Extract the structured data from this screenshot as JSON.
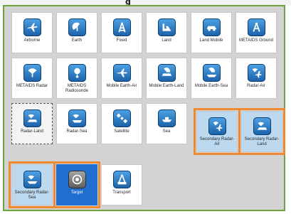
{
  "title_fragment": "g",
  "tiles": [
    {
      "label": "Airborne",
      "icon": "airborne-icon"
    },
    {
      "label": "Earth",
      "icon": "earth-icon"
    },
    {
      "label": "Fixed",
      "icon": "fixed-antenna-icon"
    },
    {
      "label": "Land",
      "icon": "land-icon"
    },
    {
      "label": "Land Mobile",
      "icon": "land-mobile-icon"
    },
    {
      "label": "METAIDS Ground",
      "icon": "metaids-ground-icon"
    },
    {
      "label": "METAIDS Radar",
      "icon": "metaids-radar-icon"
    },
    {
      "label": "METAIDS Radiosonde",
      "icon": "radiosonde-icon"
    },
    {
      "label": "Mobile Earth-Air",
      "icon": "mobile-earth-air-icon"
    },
    {
      "label": "Mobile Earth-Land",
      "icon": "mobile-earth-land-icon"
    },
    {
      "label": "Mobile Earth-Sea",
      "icon": "mobile-earth-sea-icon"
    },
    {
      "label": "Radar-Air",
      "icon": "radar-air-icon"
    },
    {
      "label": "Radar-Land",
      "icon": "radar-land-icon"
    },
    {
      "label": "Radar-Sea",
      "icon": "radar-sea-icon"
    },
    {
      "label": "Satellite",
      "icon": "satellite-icon"
    },
    {
      "label": "Sea",
      "icon": "sea-icon"
    },
    {
      "label": "Secondary Radar-Air",
      "icon": "secondary-radar-air-icon"
    },
    {
      "label": "Secondary Radar-Land",
      "icon": "secondary-radar-land-icon"
    },
    {
      "label": "Secondary Radar-Sea",
      "icon": "secondary-radar-sea-icon"
    },
    {
      "label": "Target",
      "icon": "target-icon"
    },
    {
      "label": "Transport",
      "icon": "transport-icon"
    }
  ],
  "colors": {
    "frame": "#6ea43e",
    "highlight": "#ef8a32",
    "selected": "#1f6fd0",
    "icon": "#1a5fa6"
  }
}
